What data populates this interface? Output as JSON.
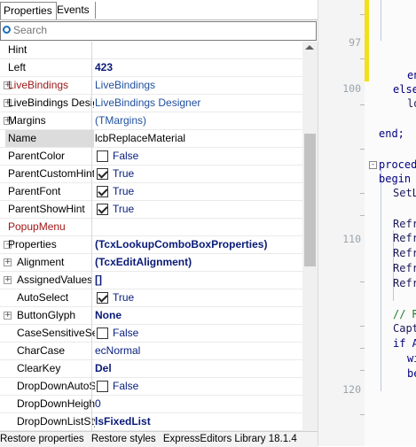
{
  "tabs": {
    "properties": "Properties",
    "events": "Events"
  },
  "search": {
    "placeholder": "Search"
  },
  "grid": {
    "hint": {
      "name": "Hint",
      "value": ""
    },
    "left": {
      "name": "Left",
      "value": "423"
    },
    "livebindings": {
      "name": "LiveBindings",
      "value": "LiveBindings"
    },
    "livebindings_designer": {
      "name": "LiveBindings Designer",
      "value": "LiveBindings Designer"
    },
    "margins": {
      "name": "Margins",
      "value": "(TMargins)"
    },
    "name": {
      "name": "Name",
      "value": "lcbReplaceMaterial"
    },
    "parentcolor": {
      "name": "ParentColor",
      "value": "False"
    },
    "parentcustomhint": {
      "name": "ParentCustomHint",
      "value": "True"
    },
    "parentfont": {
      "name": "ParentFont",
      "value": "True"
    },
    "parentshowhint": {
      "name": "ParentShowHint",
      "value": "True"
    },
    "popupmenu": {
      "name": "PopupMenu",
      "value": ""
    },
    "properties": {
      "name": "Properties",
      "value": "(TcxLookupComboBoxProperties)"
    },
    "alignment": {
      "name": "Alignment",
      "value": "(TcxEditAlignment)"
    },
    "assignedvalues": {
      "name": "AssignedValues",
      "value": "[]"
    },
    "autoselect": {
      "name": "AutoSelect",
      "value": "True"
    },
    "buttonglyph": {
      "name": "ButtonGlyph",
      "value": "None"
    },
    "casesensitivesearch": {
      "name": "CaseSensitiveSearch",
      "value": "False"
    },
    "charcase": {
      "name": "CharCase",
      "value": "ecNormal"
    },
    "clearkey": {
      "name": "ClearKey",
      "value": "Del"
    },
    "dropdownautosize": {
      "name": "DropDownAutoSize",
      "value": "False"
    },
    "dropdownheight": {
      "name": "DropDownHeight",
      "value": "0"
    },
    "dropdownliststyle": {
      "name": "DropDownListStyle",
      "value": "lsFixedList"
    }
  },
  "expander": {
    "collapsed": "+",
    "expanded": "-"
  },
  "status": {
    "restore_properties": "Restore properties",
    "restore_styles": "Restore styles",
    "library": "ExpressEditors Library 18.1.4"
  },
  "editor": {
    "line_numbers": {
      "l97": "97",
      "l100": "100",
      "l110": "110",
      "l120": "120"
    },
    "lines": {
      "en": "en",
      "else": "else",
      "lo": "lo",
      "end": "end;",
      "proced": "proced",
      "begin": "begin",
      "setl": "SetL",
      "refr1": "Refr",
      "refr2": "Refr",
      "refr3": "Refr",
      "refr4": "Refr",
      "refr5": "Refr",
      "comment": "// R",
      "capt": "Capt",
      "if": "if A",
      "wi": "wi",
      "be": "be"
    },
    "colors": {
      "change_bar": "#f2e01a",
      "keyword": "#000080",
      "comment": "#1f7a2a"
    }
  }
}
